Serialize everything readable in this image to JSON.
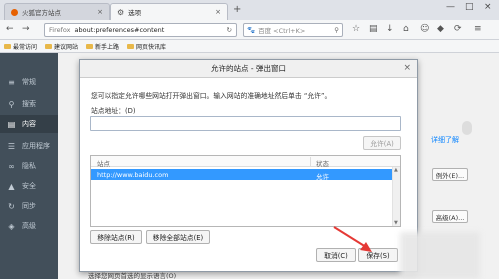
{
  "tabs": [
    {
      "label": "火狐官方站点",
      "close": "×"
    },
    {
      "label": "选项",
      "close": "×"
    }
  ],
  "new_tab": "+",
  "window_controls": [
    "—",
    "□",
    "×"
  ],
  "url": {
    "identity": "Firefox",
    "value": "about:preferences#content"
  },
  "search": {
    "placeholder": "百度 <Ctrl+K>"
  },
  "bookmarks": [
    "最常访问",
    "建议网站",
    "新手上路",
    "网页快讯库"
  ],
  "sidebar": {
    "items": [
      {
        "label": "常规",
        "icon": "≡"
      },
      {
        "label": "搜索",
        "icon": "⚲"
      },
      {
        "label": "内容",
        "icon": "▤"
      },
      {
        "label": "应用程序",
        "icon": "☰"
      },
      {
        "label": "隐私",
        "icon": "∞"
      },
      {
        "label": "安全",
        "icon": "▲"
      },
      {
        "label": "同步",
        "icon": "↻"
      },
      {
        "label": "高级",
        "icon": "◈"
      }
    ]
  },
  "content": {
    "learn_more": "详细了解",
    "exceptions_button": "例外(E)...",
    "advanced_button": "高级(A)...",
    "bottom_text": "选择您网页首选的显示语言(O)"
  },
  "dialog": {
    "title": "允许的站点 - 弹出窗口",
    "close": "×",
    "description": "您可以指定允许哪些网站打开弹出窗口。输入网站的准确地址然后单击 “允许”。",
    "address_label": "站点地址：(D)",
    "address_value": "",
    "allow_button": "允许(A)",
    "columns": [
      "站点",
      "状态"
    ],
    "rows": [
      {
        "site": "http://www.baidu.com",
        "status": "允许"
      }
    ],
    "remove_site": "移除站点(R)",
    "remove_all": "移除全部站点(E)",
    "cancel": "取消(C)",
    "save": "保存(S)"
  },
  "colors": {
    "sidebar_bg": "#424f5a",
    "selected_row": "#3399ff",
    "annotation_arrow": "#e53935",
    "link": "#0a84ff"
  }
}
